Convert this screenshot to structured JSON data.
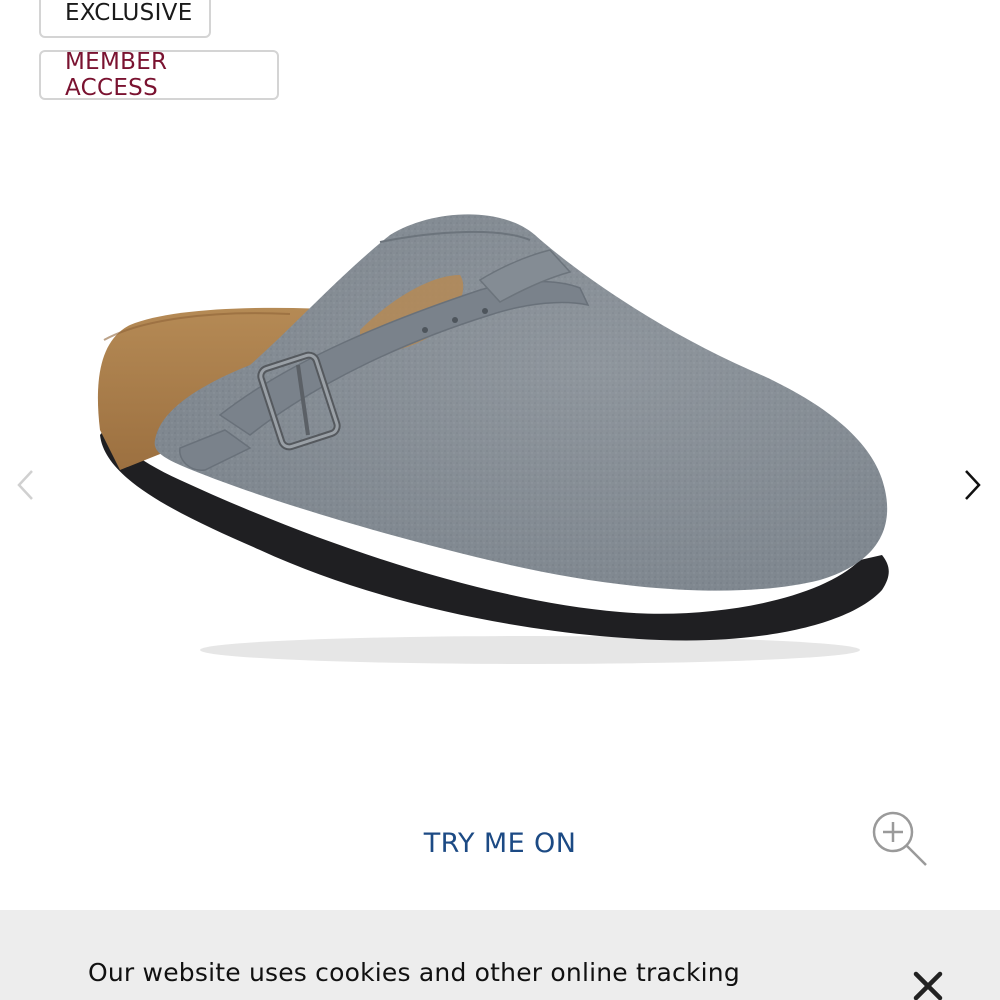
{
  "badges": {
    "exclusive": "EXCLUSIVE",
    "member_access": "MEMBER ACCESS"
  },
  "product_image": {
    "alt": "Grey suede clog with buckle strap, cork footbed and black sole"
  },
  "carousel": {
    "prev_icon": "chevron-left-icon",
    "next_icon": "chevron-right-icon"
  },
  "try_on": {
    "label": "TRY ME ON"
  },
  "zoom": {
    "icon": "zoom-in-icon"
  },
  "cookie_banner": {
    "text": "Our website uses cookies and other online tracking",
    "close_icon": "close-icon"
  },
  "colors": {
    "member_access": "#7a1230",
    "try_on": "#1c4a84",
    "banner_bg": "#ededed"
  }
}
